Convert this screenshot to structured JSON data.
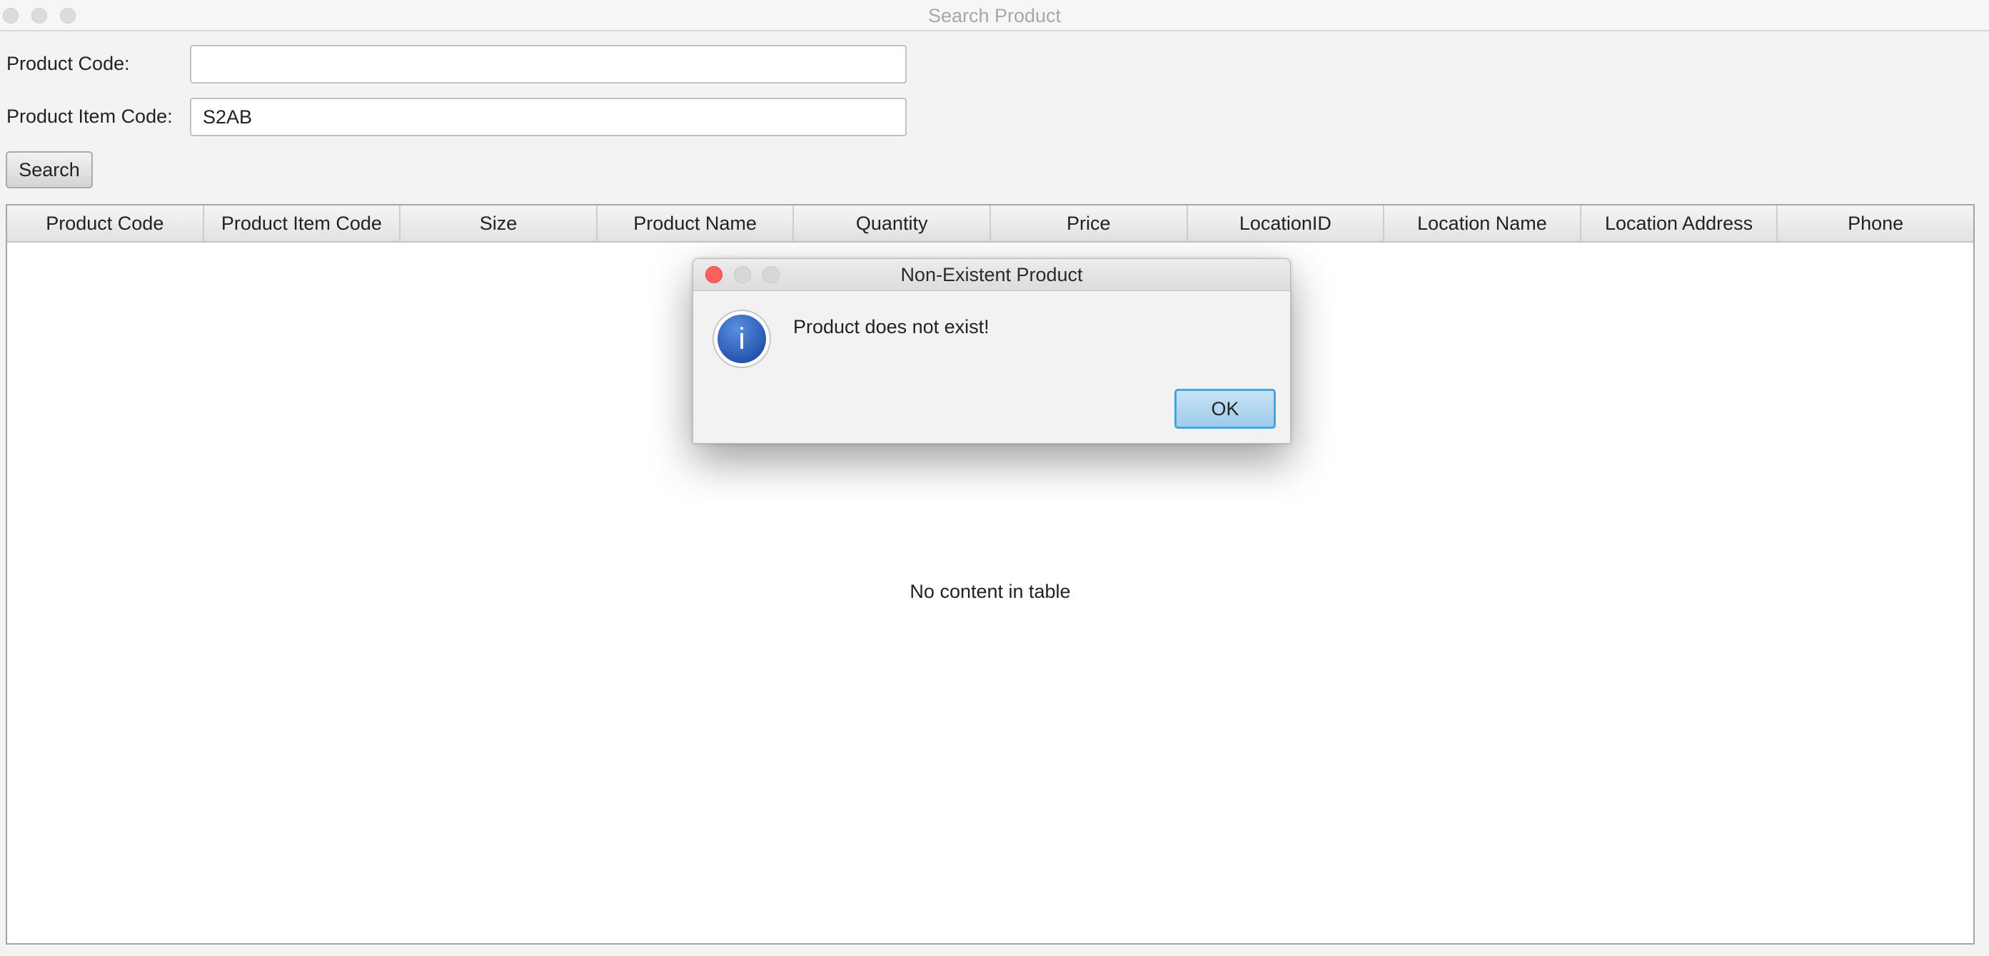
{
  "window": {
    "title": "Search Product"
  },
  "form": {
    "product_code_label": "Product Code:",
    "product_code_value": "",
    "product_item_code_label": "Product Item Code:",
    "product_item_code_value": "S2AB",
    "search_label": "Search"
  },
  "table": {
    "columns": [
      "Product Code",
      "Product Item Code",
      "Size",
      "Product Name",
      "Quantity",
      "Price",
      "LocationID",
      "Location Name",
      "Location Address",
      "Phone"
    ],
    "rows": [],
    "placeholder": "No content in table"
  },
  "dialog": {
    "title": "Non-Existent Product",
    "message": "Product does not exist!",
    "icon": "info-icon",
    "icon_glyph": "i",
    "ok_label": "OK"
  },
  "colors": {
    "close_button": "#fc605b",
    "ok_button_border": "#46a4df",
    "info_icon": "#2f66c4"
  }
}
